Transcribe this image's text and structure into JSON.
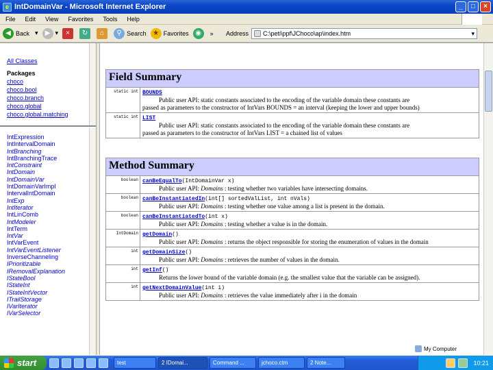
{
  "window": {
    "title": "IntDomainVar - Microsoft Internet Explorer",
    "icon": "ie-icon"
  },
  "menu": [
    "File",
    "Edit",
    "View",
    "Favorites",
    "Tools",
    "Help"
  ],
  "toolbar": {
    "back": "Back",
    "search": "Search",
    "favorites": "Favorites",
    "more": "»",
    "address_label": "Address",
    "address_value": "C:\\peti\\ppf\\JChoco\\ap\\index.htm"
  },
  "left_top": {
    "all_classes": "All Classes",
    "packages_title": "Packages",
    "packages": [
      "choco",
      "choco.bool",
      "choco.branch",
      "choco.global",
      "choco.global.matching"
    ]
  },
  "left_list": [
    {
      "t": "IntExpression",
      "i": false
    },
    {
      "t": "IntIntervalDomain",
      "i": false
    },
    {
      "t": "IntBranching",
      "i": true
    },
    {
      "t": "IntBranchingTrace",
      "i": false
    },
    {
      "t": "IntConstraint",
      "i": true
    },
    {
      "t": "IntDomain",
      "i": true
    },
    {
      "t": "IntDomainVar",
      "i": true
    },
    {
      "t": "IntDomainVarImpl",
      "i": false
    },
    {
      "t": "IntervalIntDomain",
      "i": false
    },
    {
      "t": "IntExp",
      "i": true
    },
    {
      "t": "IntIterator",
      "i": true
    },
    {
      "t": "IntLinComb",
      "i": false
    },
    {
      "t": "IntModeler",
      "i": true
    },
    {
      "t": "IntTerm",
      "i": false
    },
    {
      "t": "IntVar",
      "i": true
    },
    {
      "t": "IntVarEvent",
      "i": false
    },
    {
      "t": "IntVarEventListener",
      "i": true
    },
    {
      "t": "InverseChanneling",
      "i": false
    },
    {
      "t": "IPrioritizable",
      "i": true
    },
    {
      "t": "IRemovalExplanation",
      "i": true
    },
    {
      "t": "IStateBool",
      "i": true
    },
    {
      "t": "IStateInt",
      "i": true
    },
    {
      "t": "IStateIntVector",
      "i": true
    },
    {
      "t": "ITrailStorage",
      "i": true
    },
    {
      "t": "IVarIterator",
      "i": true
    },
    {
      "t": "IVarSelector",
      "i": true
    }
  ],
  "field_summary": {
    "title": "Field Summary",
    "rows": [
      {
        "mod": "static int",
        "name": "BOUNDS",
        "desc1": "Public user API: static constants associated to the encoding of the variable domain these constants are",
        "desc2": "passed as parameters to the constructor of IntVars BOUNDS = an interval (keeping the lower and upper bounds)"
      },
      {
        "mod": "static int",
        "name": "LIST",
        "desc1": "Public user API: static constants associated to the encoding of the variable domain these constants are",
        "desc2": "passed as parameters to the constructor of IntVars LIST = a chained list of values"
      }
    ]
  },
  "method_summary": {
    "title": "Method Summary",
    "rows": [
      {
        "mod": "boolean",
        "name": "canBeEqualTo",
        "sig": "(IntDomainVar x)",
        "prefix": "Public user API: ",
        "em": "Domains",
        "rest": " : testing whether two variables have intersecting domains."
      },
      {
        "mod": "boolean",
        "name": "canBeInstantiatedIn",
        "sig": "(int[] sortedValList, int nVals)",
        "prefix": "Public user API: ",
        "em": "Domains",
        "rest": " : testing whether one value among a list is present in the domain."
      },
      {
        "mod": "boolean",
        "name": "canBeInstantiatedTo",
        "sig": "(int x)",
        "prefix": "Public user API: ",
        "em": "Domains",
        "rest": " : testing whether a value is in the domain."
      },
      {
        "mod": "IntDomain",
        "name": "getDomain",
        "sig": "()",
        "prefix": "Public user API: ",
        "em": "Domains",
        "rest": " : returns the object responsible for storing the enumeration of values in the domain"
      },
      {
        "mod": "int",
        "name": "getDomainSize",
        "sig": "()",
        "prefix": "Public user API: ",
        "em": "Domains",
        "rest": " : retrieves the number of values in the domain."
      },
      {
        "mod": "int",
        "name": "getInf",
        "sig": "()",
        "prefix": "",
        "em": "",
        "rest": "Returns the lower bound of the variable domain (e.g. the smallest value that the variable can be assigned)."
      },
      {
        "mod": "int",
        "name": "getNextDomainValue",
        "sig": "(int i)",
        "prefix": "Public user API: ",
        "em": "Domains",
        "rest": " : retrieves the value immediately after i in the domain"
      }
    ]
  },
  "status": {
    "zone": "My Computer"
  },
  "taskbar": {
    "start": "start",
    "tasks": [
      "test",
      "2 IDomai...",
      "Command ...",
      "jchoco.ctm",
      "2 Note..."
    ],
    "clock": "10:21"
  }
}
